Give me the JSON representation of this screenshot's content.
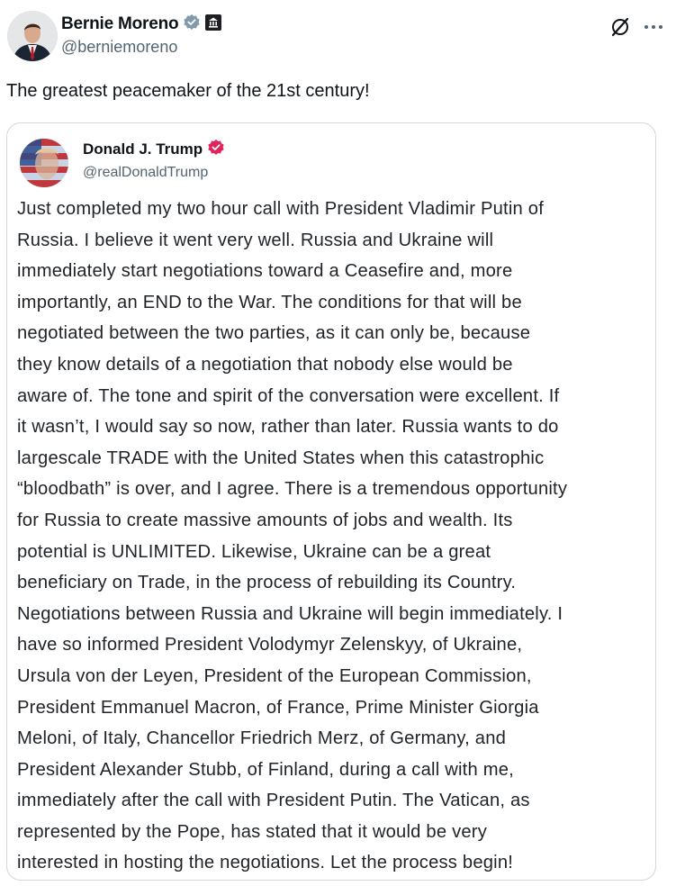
{
  "post": {
    "author": {
      "name": "Bernie Moreno",
      "handle": "@berniemoreno",
      "verified_icon": "verified-badge-gray",
      "affiliation_icon": "government-building-icon"
    },
    "actions": {
      "grok_icon": "grok-slash-circle-icon",
      "more_icon": "more-dots-icon"
    },
    "text": "The greatest peacemaker of the 21st century!"
  },
  "quote": {
    "author": {
      "name": "Donald J. Trump",
      "handle": "@realDonaldTrump",
      "verified_icon": "verified-badge-red"
    },
    "lines": [
      "Just completed my two hour call with President Vladimir Putin of",
      "Russia. I believe it went very well. Russia and Ukraine will",
      "immediately start negotiations toward a Ceasefire and, more",
      "importantly, an END to the War. The conditions for that will be",
      "negotiated between the two parties, as it can only be, because",
      "they know details of a negotiation that nobody else would be",
      "aware of. The tone and spirit of the conversation were excellent. If",
      "it wasn’t, I would say so now, rather than later. Russia wants to do",
      "largescale TRADE with the United States when this catastrophic",
      "“bloodbath” is over, and I agree. There is a tremendous opportunity",
      "for Russia to create massive amounts of jobs and wealth. Its",
      "potential is UNLIMITED. Likewise, Ukraine can be a great",
      "beneficiary on Trade, in the process of rebuilding its Country.",
      "Negotiations between Russia and Ukraine will begin immediately. I",
      "have so informed President Volodymyr Zelenskyy, of Ukraine,",
      "Ursula von der Leyen, President of the European Commission,",
      "President Emmanuel Macron, of France, Prime Minister Giorgia",
      "Meloni, of Italy, Chancellor Friedrich Merz, of Germany, and",
      "President Alexander Stubb, of Finland, during a call with me,",
      "immediately after the call with President Putin. The Vatican, as",
      "represented by the Pope, has stated that it would be very",
      "interested in hosting the negotiations. Let the process begin!"
    ]
  },
  "colors": {
    "text": "#0f1419",
    "secondary_text": "#536471",
    "border": "#cfd9de",
    "verified_gray": "#829aab",
    "verified_red": "#e0245e"
  }
}
